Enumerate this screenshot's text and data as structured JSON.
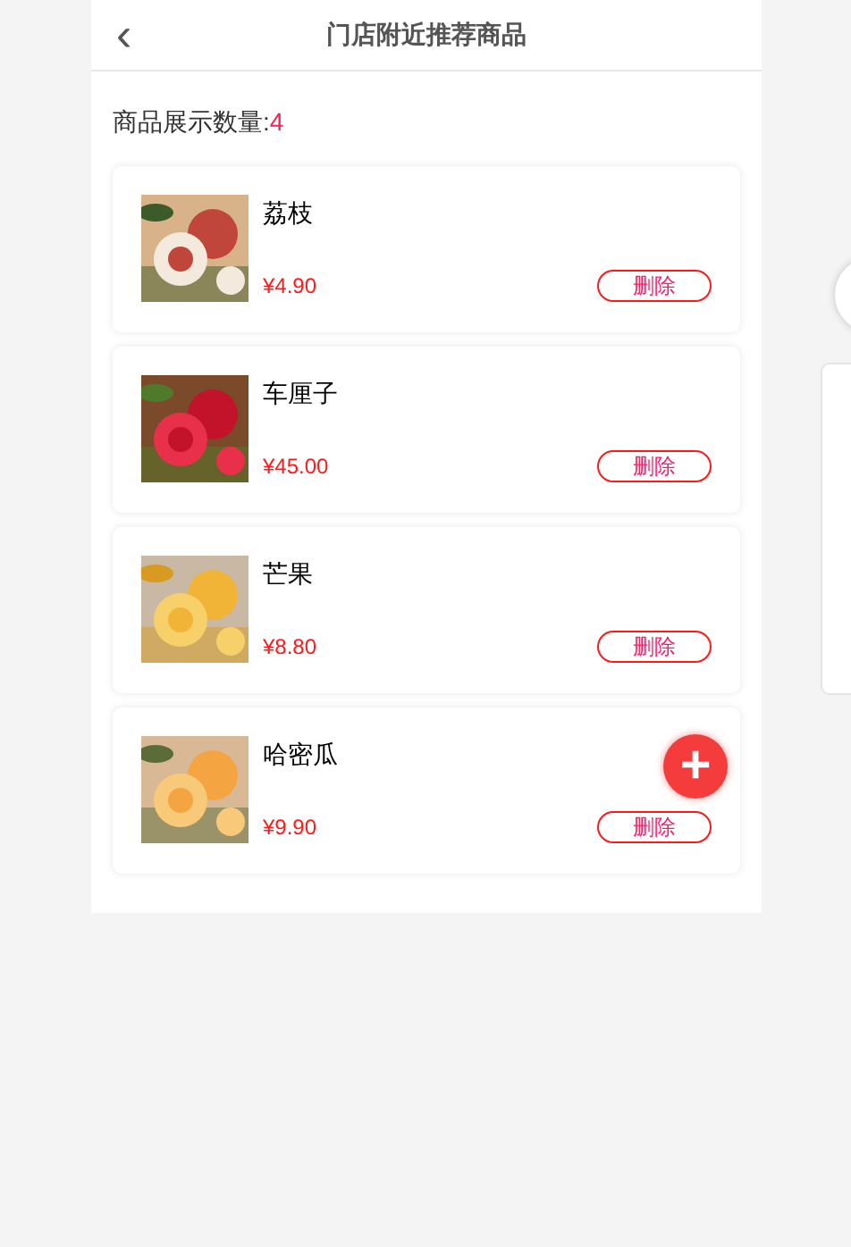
{
  "header": {
    "back_icon": "‹",
    "title": "门店附近推荐商品"
  },
  "count": {
    "label": "商品展示数量:",
    "value": "4"
  },
  "products": [
    {
      "name": "荔枝",
      "price": "¥4.90",
      "action": "删除"
    },
    {
      "name": "车厘子",
      "price": "¥45.00",
      "action": "删除"
    },
    {
      "name": "芒果",
      "price": "¥8.80",
      "action": "删除"
    },
    {
      "name": "哈密瓜",
      "price": "¥9.90",
      "action": "删除"
    }
  ],
  "fab": "+"
}
